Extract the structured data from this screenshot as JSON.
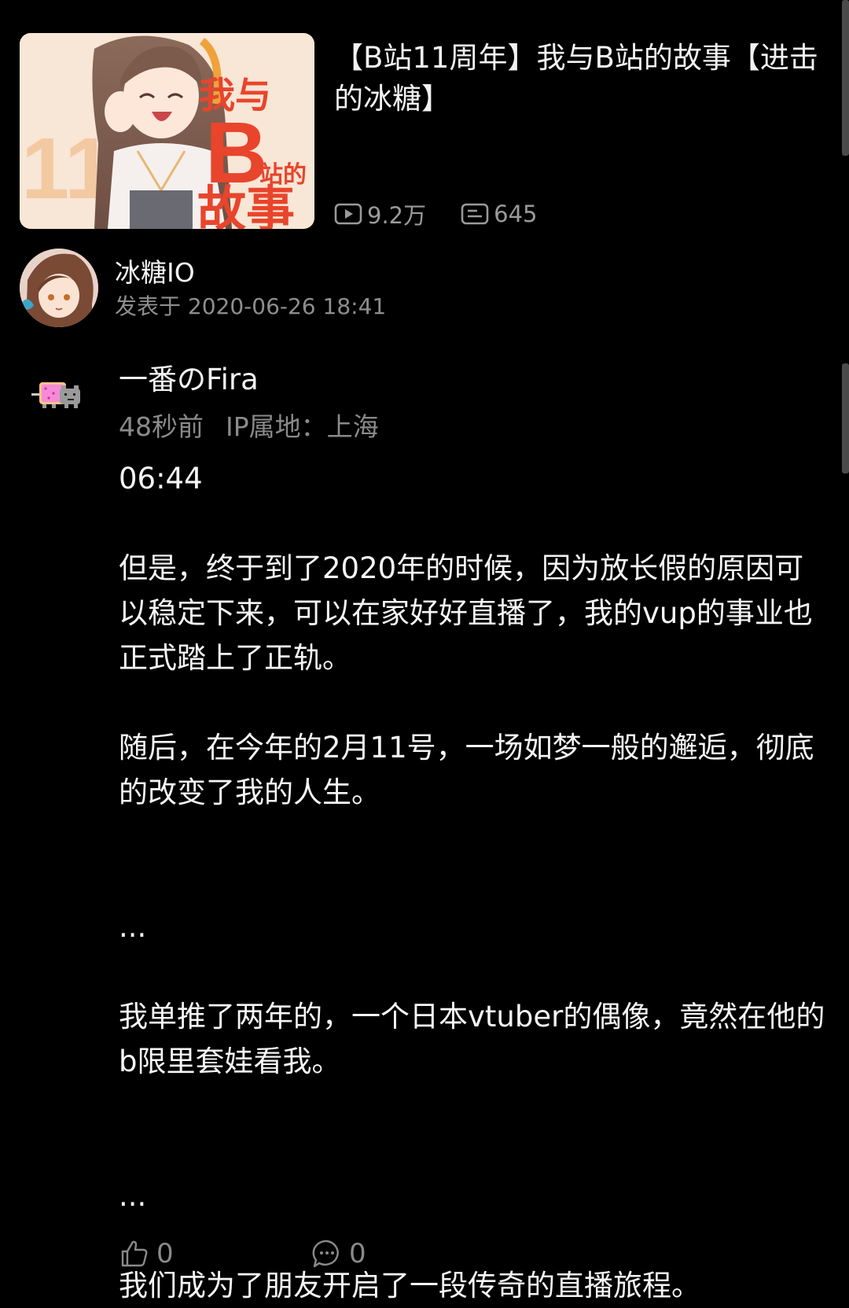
{
  "video": {
    "title": "【B站11周年】我与B站的故事【进击的冰糖】",
    "thumbnail_text": [
      "我与",
      "B",
      "站的",
      "故事",
      "11"
    ],
    "play_count": "9.2万",
    "danmaku_count": "645",
    "play_icon": "play-icon",
    "danmaku_icon": "danmaku-icon"
  },
  "uploader": {
    "name": "冰糖IO",
    "posted": "发表于 2020-06-26 18:41"
  },
  "comment": {
    "author": "一番のFira",
    "time": "48秒前",
    "ip": "IP属地：上海",
    "paragraphs": [
      "06:44",
      "但是，终于到了2020年的时候，因为放长假的原因可以稳定下来，可以在家好好直播了，我的vup的事业也正式踏上了正轨。",
      "随后，在今年的2月11号，一场如梦一般的邂逅，彻底的改变了我的人生。",
      "...",
      "我单推了两年的，一个日本vtuber的偶像，竟然在他的b限里套娃看我。",
      "...",
      "我们成为了朋友开启了一段传奇的直播旅程。"
    ],
    "like_count": "0",
    "reply_count": "0"
  },
  "colors": {
    "background": "#000000",
    "text_primary": "#f5f5f5",
    "text_secondary": "#8a8a8a",
    "thumbnail_accent": "#e8452c"
  }
}
